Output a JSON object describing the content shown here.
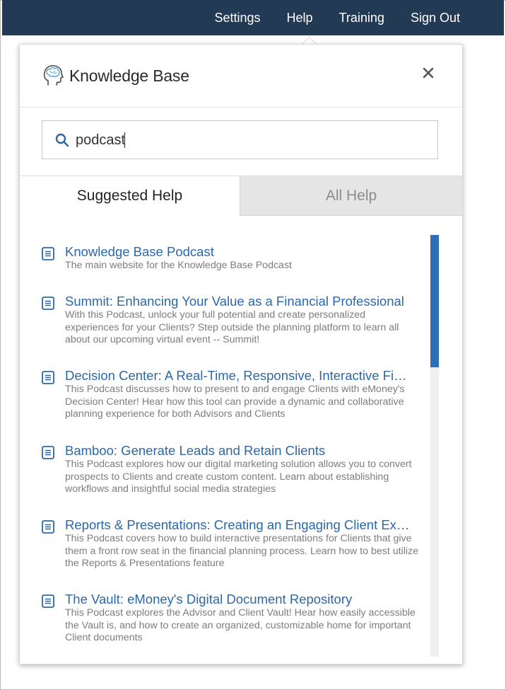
{
  "topnav": {
    "items": [
      {
        "label": "Settings"
      },
      {
        "label": "Help"
      },
      {
        "label": "Training"
      },
      {
        "label": "Sign Out"
      }
    ]
  },
  "panel": {
    "title": "Knowledge Base",
    "icons": {
      "logo": "brain-head-icon",
      "close": "close-icon",
      "search": "search-icon",
      "document": "document-icon"
    },
    "search": {
      "value": "podcast",
      "placeholder": ""
    }
  },
  "tabs": [
    {
      "label": "Suggested Help",
      "active": true
    },
    {
      "label": "All Help",
      "active": false
    }
  ],
  "results": [
    {
      "title": "Knowledge Base Podcast",
      "description": "The main website for the Knowledge Base Podcast"
    },
    {
      "title": "Summit: Enhancing Your Value as a Financial Professional",
      "description": "With this Podcast, unlock your full potential and create personalized experiences for your Clients? Step outside the planning platform to learn all about our upcoming virtual event -- Summit!"
    },
    {
      "title": "Decision Center: A Real-Time, Responsive, Interactive Fi…",
      "description": "This Podcast discusses how to present to and engage Clients with eMoney's Decision Center! Hear how this tool can provide a dynamic and collaborative planning experience for both Advisors and Clients"
    },
    {
      "title": "Bamboo: Generate Leads and Retain Clients",
      "description": "This Podcast explores how our digital marketing solution allows you to convert prospects to Clients and create custom content. Learn about establishing workflows and insightful social media strategies"
    },
    {
      "title": "Reports & Presentations: Creating an Engaging Client Ex…",
      "description": "This Podcast covers how to build interactive presentations for Clients that give them a front row seat in the financial planning process. Learn how to best utilize the Reports & Presentations feature"
    },
    {
      "title": "The Vault: eMoney's Digital Document Repository",
      "description": "This Podcast explores the Advisor and Client Vault! Hear how easily accessible the Vault is, and how to create an organized, customizable home for important Client documents"
    }
  ],
  "colors": {
    "topbar": "#233a55",
    "link": "#2c68a8",
    "scroll_thumb": "#2f6db5",
    "inactive_tab": "#e5e5e5"
  }
}
